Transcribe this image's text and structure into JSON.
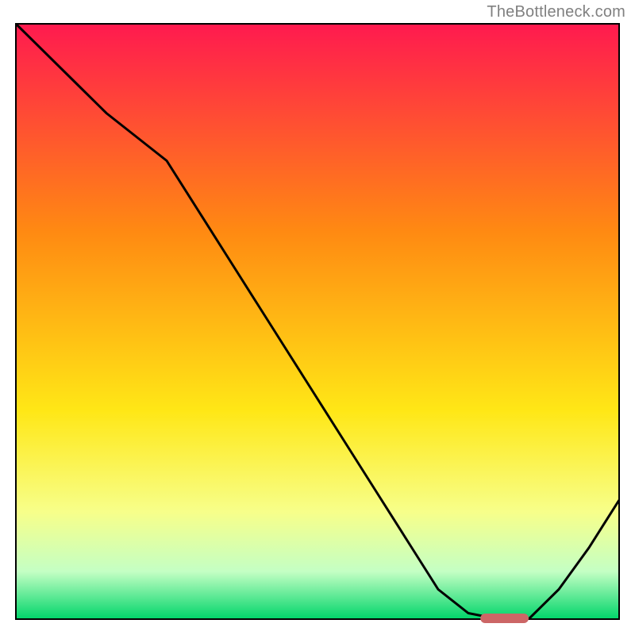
{
  "watermark": "TheBottleneck.com",
  "colors": {
    "gradient_top": "#ff1a4f",
    "gradient_mid1": "#ff8a12",
    "gradient_mid2": "#ffe716",
    "gradient_low1": "#f7ff8a",
    "gradient_low2": "#c4ffc4",
    "gradient_bottom": "#00d56a",
    "border": "#000000",
    "curve": "#000000",
    "marker": "#cc6666"
  },
  "chart_data": {
    "type": "line",
    "title": "",
    "xlabel": "",
    "ylabel": "",
    "xlim": [
      0,
      1
    ],
    "ylim": [
      0,
      1
    ],
    "series": [
      {
        "name": "bottleneck-curve",
        "x": [
          0.0,
          0.05,
          0.1,
          0.15,
          0.2,
          0.25,
          0.3,
          0.35,
          0.4,
          0.45,
          0.5,
          0.55,
          0.6,
          0.65,
          0.7,
          0.75,
          0.8,
          0.85,
          0.9,
          0.95,
          1.0
        ],
        "values": [
          1.0,
          0.95,
          0.9,
          0.85,
          0.81,
          0.77,
          0.69,
          0.61,
          0.53,
          0.45,
          0.37,
          0.29,
          0.21,
          0.13,
          0.05,
          0.01,
          0.0,
          0.0,
          0.05,
          0.12,
          0.2
        ]
      }
    ],
    "marker": {
      "name": "optimal-range",
      "x_start": 0.77,
      "x_end": 0.85,
      "y": 0.0
    },
    "annotations": []
  }
}
